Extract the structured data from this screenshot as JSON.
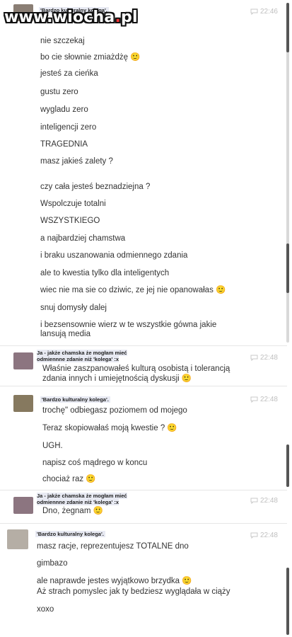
{
  "watermark": {
    "pre": "www.wiocha",
    "dot": ".",
    "post": "pl"
  },
  "senders": {
    "friend": "'Bardzo kulturalny kolega'.",
    "me": "Ja - jakże chamska że mogłam mieć odmiennne zdanie niż 'kolega' :x"
  },
  "blocks": [
    {
      "time": "22:46",
      "messages": [
        "nie szczekaj",
        "bo cie słownie zmiażdżę 🙂",
        "jesteś za cieńka",
        "gustu zero",
        "wygladu zero",
        "inteligencji zero",
        "TRAGEDNIA",
        "masz jakieś zalety ?",
        "czy cała jesteś beznadziejna ?",
        "Wspolczuje totalni",
        "WSZYSTKIEGO",
        "a najbardziej chamstwa",
        "i braku uszanowania odmiennego zdania",
        "ale to kwestia tylko dla inteligentych",
        "wiec nie ma sie co dziwic, ze jej nie opanowałas 🙂",
        "snuj domysły dalej",
        "i bezsensownie wierz w te wszystkie gówna jakie lansują media"
      ]
    },
    {
      "time": "22:48",
      "messages": [
        "Właśnie zaszpanowałeś kulturą osobistą i tolerancją zdania innych i umiejętnością dyskusji 🙂"
      ]
    },
    {
      "time": "22:48",
      "messages": [
        "trochę\" odbiegasz poziomem od mojego",
        "Teraz skopiowałaś moją kwestie ? 🙂",
        "UGH.",
        "napisz coś mądrego w koncu",
        "chociaż raz 🙂"
      ]
    },
    {
      "time": "22:48",
      "messages": [
        "Dno, żegnam 🙂"
      ]
    },
    {
      "time": "22:48",
      "messages": [
        "masz racje, reprezentujesz TOTALNE dno",
        "gimbazo",
        "ale naprawde jestes wyjątkowo brzydka 🙂",
        "Aż strach pomyslec jak ty bedziesz wyglądała w ciąży",
        "xoxo"
      ]
    }
  ]
}
